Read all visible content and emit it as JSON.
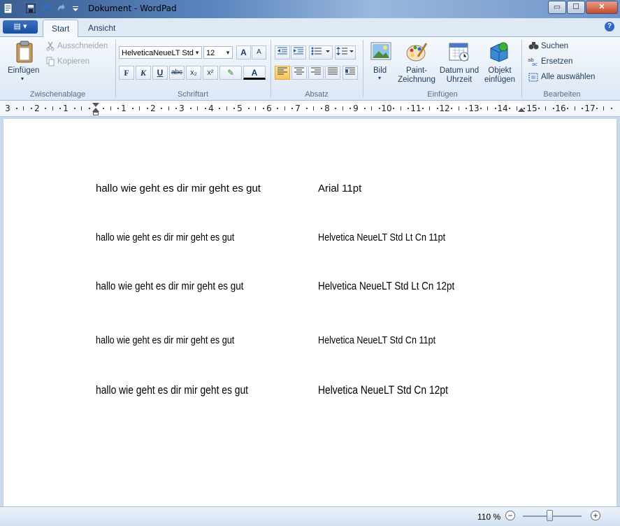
{
  "window": {
    "title": "Dokument - WordPad",
    "min_label": "▭",
    "max_label": "☐",
    "close_label": "✕"
  },
  "quick_access": {
    "app_menu_label": "▤ ▾"
  },
  "tabs": [
    {
      "label": "Start",
      "active": true
    },
    {
      "label": "Ansicht",
      "active": false
    }
  ],
  "help_label": "?",
  "ribbon": {
    "clipboard": {
      "paste_label": "Einfügen",
      "cut_label": "Ausschneiden",
      "copy_label": "Kopieren",
      "group_label": "Zwischenablage"
    },
    "font": {
      "font_name": "HelveticaNeueLT Std",
      "font_size": "12",
      "grow_label": "A",
      "shrink_label": "A",
      "bold": "F",
      "italic": "K",
      "underline": "U",
      "strike": "abc",
      "subscript": "x₂",
      "superscript": "x²",
      "highlight_label": "✎",
      "color_label": "A",
      "group_label": "Schriftart"
    },
    "paragraph": {
      "group_label": "Absatz"
    },
    "insert": {
      "picture_label": "Bild",
      "paint_label_1": "Paint-",
      "paint_label_2": "Zeichnung",
      "datetime_label_1": "Datum und",
      "datetime_label_2": "Uhrzeit",
      "object_label_1": "Objekt",
      "object_label_2": "einfügen",
      "group_label": "Einfügen"
    },
    "editing": {
      "find_label": "Suchen",
      "replace_label": "Ersetzen",
      "select_all_label": "Alle auswählen",
      "group_label": "Bearbeiten"
    }
  },
  "ruler": {
    "numbers": [
      "3",
      "2",
      "1",
      "1",
      "2",
      "3",
      "4",
      "5",
      "6",
      "7",
      "8",
      "9",
      "10",
      "11",
      "12",
      "13",
      "14",
      "15",
      "16",
      "17"
    ]
  },
  "document": {
    "lines": [
      {
        "text": "hallo wie geht es dir mir geht es gut",
        "label": "Arial 11pt"
      },
      {
        "text": "hallo wie geht es dir mir geht es gut",
        "label": "Helvetica NeueLT Std Lt Cn 11pt"
      },
      {
        "text": "hallo wie geht es dir mir geht es gut",
        "label": "Helvetica NeueLT Std Lt Cn 12pt"
      },
      {
        "text": "hallo wie geht es dir mir geht es gut",
        "label": "Helvetica NeueLT Std Cn 11pt"
      },
      {
        "text": "hallo wie geht es dir mir geht es gut",
        "label": "Helvetica NeueLT Std Cn 12pt"
      }
    ]
  },
  "status": {
    "zoom": "110 %",
    "zoom_out": "−",
    "zoom_in": "+",
    "zoom_level": 0.45
  }
}
